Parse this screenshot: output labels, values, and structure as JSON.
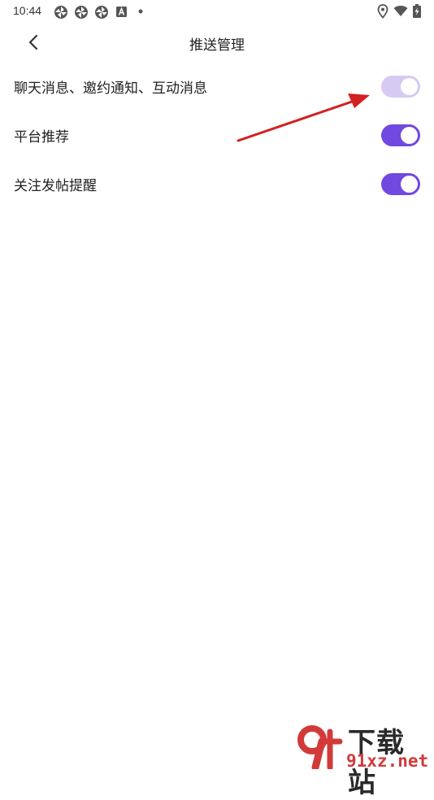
{
  "status_bar": {
    "time": "10:44",
    "left_icons": [
      "pinwheel-icon",
      "pinwheel-icon",
      "pinwheel-icon",
      "a-box-icon",
      "dot-icon"
    ],
    "right_icons": [
      "location-icon",
      "wifi-icon",
      "battery-charging-icon"
    ]
  },
  "nav": {
    "title": "推送管理",
    "back_icon": "chevron-left-icon"
  },
  "settings": [
    {
      "label": "聊天消息、邀约通知、互动消息",
      "enabled": true,
      "appearance": "faded"
    },
    {
      "label": "平台推荐",
      "enabled": true,
      "appearance": "active"
    },
    {
      "label": "关注发帖提醒",
      "enabled": true,
      "appearance": "active"
    }
  ],
  "colors": {
    "toggle_active": "#7148e0",
    "toggle_faded": "#d6caf3",
    "annotation_arrow": "#d32020",
    "watermark_red": "#d23a3a"
  },
  "watermark": {
    "logo_text": "下载站",
    "url": "91xz.net",
    "logo_mark": "9f"
  }
}
